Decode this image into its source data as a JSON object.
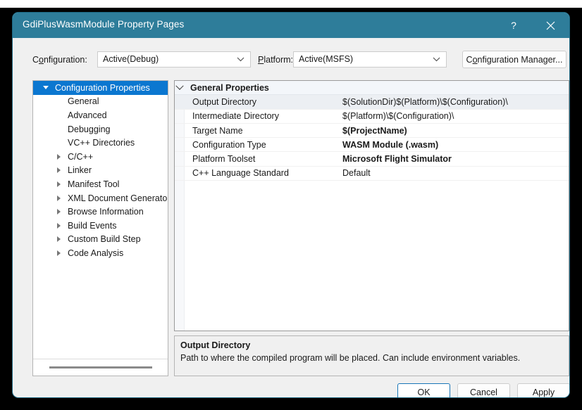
{
  "window": {
    "title": "GdiPlusWasmModule Property Pages",
    "help_glyph": "?",
    "close_glyph": "✕"
  },
  "config_bar": {
    "configuration_label": "Configuration:",
    "configuration_label_parts": {
      "pre": "C",
      "accel": "o",
      "post": "nfiguration:"
    },
    "configuration_value": "Active(Debug)",
    "platform_label": "Platform:",
    "platform_label_parts": {
      "pre": "",
      "accel": "P",
      "post": "latform:"
    },
    "platform_value": "Active(MSFS)",
    "configuration_manager_label": "Configuration Manager...",
    "configuration_manager_parts": {
      "pre": "C",
      "accel": "o",
      "post": "nfiguration Manager..."
    }
  },
  "tree": {
    "items": [
      {
        "label": "Configuration Properties",
        "indent": 0,
        "expander": "down",
        "selected": true
      },
      {
        "label": "General",
        "indent": 1,
        "expander": "none",
        "selected": false
      },
      {
        "label": "Advanced",
        "indent": 1,
        "expander": "none",
        "selected": false
      },
      {
        "label": "Debugging",
        "indent": 1,
        "expander": "none",
        "selected": false
      },
      {
        "label": "VC++ Directories",
        "indent": 1,
        "expander": "none",
        "selected": false
      },
      {
        "label": "C/C++",
        "indent": 1,
        "expander": "right",
        "selected": false
      },
      {
        "label": "Linker",
        "indent": 1,
        "expander": "right",
        "selected": false
      },
      {
        "label": "Manifest Tool",
        "indent": 1,
        "expander": "right",
        "selected": false
      },
      {
        "label": "XML Document Generator",
        "indent": 1,
        "expander": "right",
        "selected": false
      },
      {
        "label": "Browse Information",
        "indent": 1,
        "expander": "right",
        "selected": false
      },
      {
        "label": "Build Events",
        "indent": 1,
        "expander": "right",
        "selected": false
      },
      {
        "label": "Custom Build Step",
        "indent": 1,
        "expander": "right",
        "selected": false
      },
      {
        "label": "Code Analysis",
        "indent": 1,
        "expander": "right",
        "selected": false
      }
    ]
  },
  "grid": {
    "rows": [
      {
        "kind": "category",
        "name": "General Properties",
        "value": "",
        "bold_value": false,
        "selected": false,
        "expander": "down"
      },
      {
        "kind": "property",
        "name": "Output Directory",
        "value": "$(SolutionDir)$(Platform)\\$(Configuration)\\",
        "bold_value": false,
        "selected": true
      },
      {
        "kind": "property",
        "name": "Intermediate Directory",
        "value": "$(Platform)\\$(Configuration)\\",
        "bold_value": false,
        "selected": false
      },
      {
        "kind": "property",
        "name": "Target Name",
        "value": "$(ProjectName)",
        "bold_value": true,
        "selected": false
      },
      {
        "kind": "property",
        "name": "Configuration Type",
        "value": "WASM Module (.wasm)",
        "bold_value": true,
        "selected": false
      },
      {
        "kind": "property",
        "name": "Platform Toolset",
        "value": "Microsoft Flight Simulator",
        "bold_value": true,
        "selected": false
      },
      {
        "kind": "property",
        "name": "C++ Language Standard",
        "value": "Default",
        "bold_value": false,
        "selected": false
      }
    ]
  },
  "description": {
    "title": "Output Directory",
    "body": "Path to where the compiled program will be placed. Can include environment variables."
  },
  "footer": {
    "ok_label": "OK",
    "cancel_label": "Cancel",
    "apply_label": "Apply"
  },
  "colors": {
    "titlebar": "#2e7d9a",
    "selection": "#0b77d0",
    "dialog_bg": "#f0f0f0",
    "default_button_border": "#1976b8"
  }
}
